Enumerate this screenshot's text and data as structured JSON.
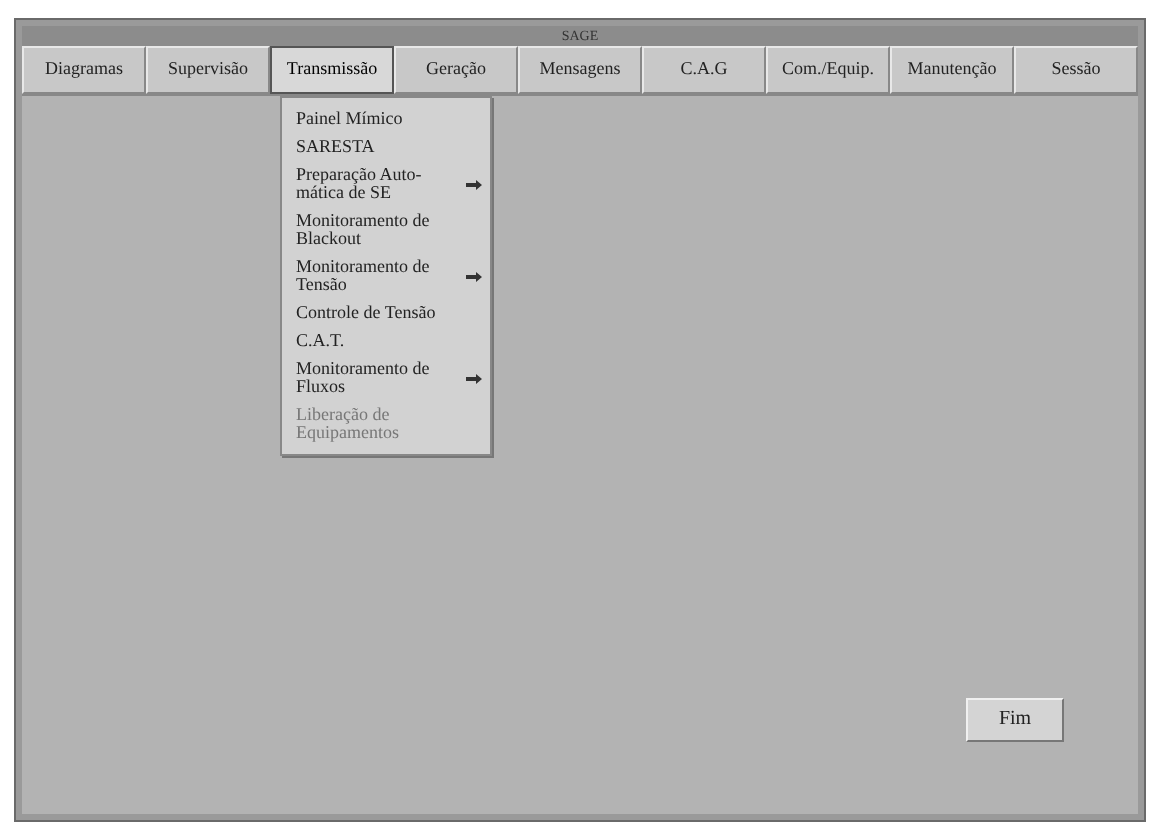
{
  "window": {
    "title": "SAGE"
  },
  "tabs": [
    {
      "label": "Diagramas",
      "selected": false
    },
    {
      "label": "Supervisão",
      "selected": false
    },
    {
      "label": "Transmissão",
      "selected": true
    },
    {
      "label": "Geração",
      "selected": false
    },
    {
      "label": "Mensagens",
      "selected": false
    },
    {
      "label": "C.A.G",
      "selected": false
    },
    {
      "label": "Com./Equip.",
      "selected": false
    },
    {
      "label": "Manutenção",
      "selected": false
    },
    {
      "label": "Sessão",
      "selected": false
    }
  ],
  "menu": [
    {
      "label": "Painel Mímico",
      "submenu": false,
      "disabled": false
    },
    {
      "label": "SARESTA",
      "submenu": false,
      "disabled": false
    },
    {
      "label": "Preparação Auto-mática de SE",
      "submenu": true,
      "disabled": false
    },
    {
      "label": "Monitoramento de Blackout",
      "submenu": false,
      "disabled": false
    },
    {
      "label": "Monitoramento de Tensão",
      "submenu": true,
      "disabled": false
    },
    {
      "label": "Controle de Tensão",
      "submenu": false,
      "disabled": false
    },
    {
      "label": "C.A.T.",
      "submenu": false,
      "disabled": false
    },
    {
      "label": "Monitoramento de Fluxos",
      "submenu": true,
      "disabled": false
    },
    {
      "label": "Liberação de Equipamentos",
      "submenu": false,
      "disabled": true
    }
  ],
  "buttons": [
    "Fim"
  ]
}
